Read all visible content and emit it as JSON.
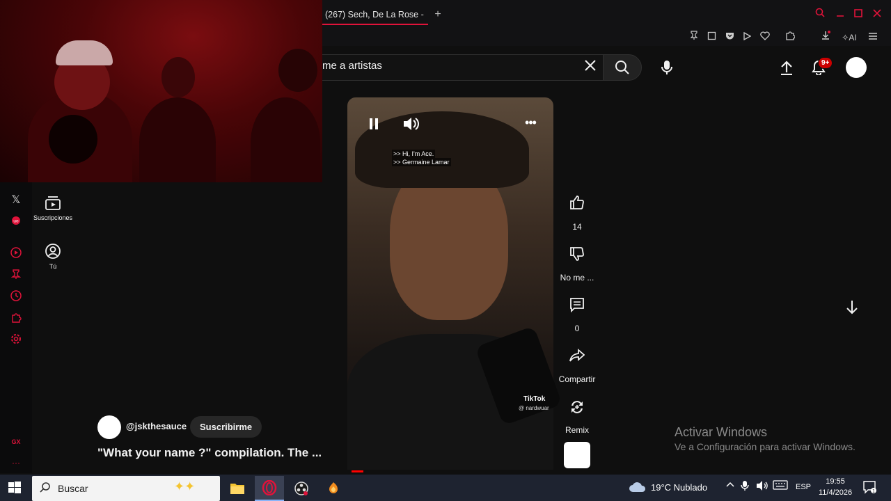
{
  "browser": {
    "tab_title": "(267) Sech, De La Rose - ",
    "new_tab": "+",
    "ai_label": "AI"
  },
  "youtube": {
    "search_value": "me  a artistas",
    "notification_count": "9+",
    "guide": [
      {
        "label": "Suscripciones",
        "icon": "subscriptions-icon"
      },
      {
        "label": "Tú",
        "icon": "you-icon"
      }
    ]
  },
  "gx_sidebar": {
    "gx_label": "GX",
    "more_label": "···"
  },
  "short": {
    "captions": [
      ">> Hi, I'm Ace.",
      ">> Germaine Lamar"
    ],
    "watermark_brand": "TikTok",
    "watermark_user": "@ nardwuar",
    "channel_handle": "@jskthesauce",
    "subscribe_label": "Suscribirme",
    "title": "\"What your name ?\" compilation. The ...",
    "actions": {
      "like_count": "14",
      "dislike_label": "No me ...",
      "comment_count": "0",
      "share_label": "Compartir",
      "remix_label": "Remix"
    },
    "progress": 0.06
  },
  "watermark": {
    "title": "Activar Windows",
    "subtitle": "Ve a Configuración para activar Windows."
  },
  "taskbar": {
    "search_placeholder": "Buscar",
    "weather": "19°C  Nublado",
    "language": "ESP",
    "time": "19:55",
    "date": "11/4/2026"
  },
  "colors": {
    "accent": "#e0133a",
    "youtube_red": "#ff0000",
    "bg": "#0f0f0f"
  }
}
